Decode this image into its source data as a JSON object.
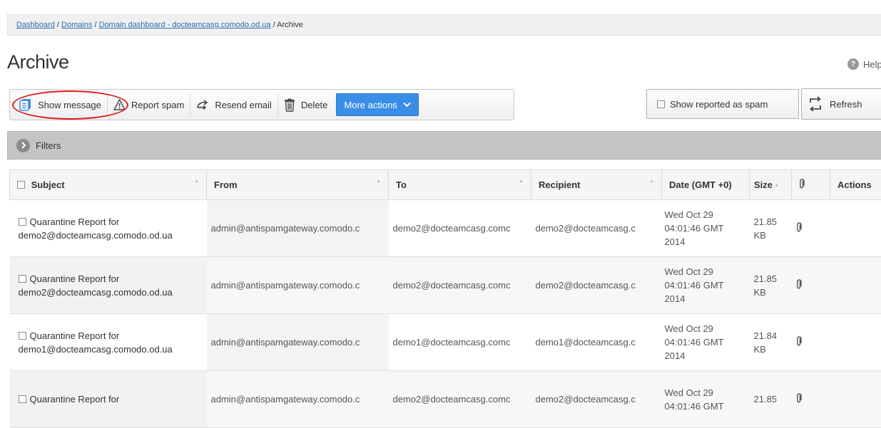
{
  "breadcrumb": {
    "links": [
      "Dashboard",
      "Domains",
      "Domain dashboard - docteamcasg.comodo.od.ua"
    ],
    "separator": "/",
    "current": "Archive"
  },
  "page": {
    "title": "Archive",
    "help_label": "Help"
  },
  "toolbar": {
    "show_message": "Show message",
    "report_spam": "Report spam",
    "resend_email": "Resend email",
    "delete": "Delete",
    "more_actions": "More actions"
  },
  "right_controls": {
    "show_reported_spam": "Show reported as spam",
    "refresh": "Refresh"
  },
  "filters": {
    "label": "Filters"
  },
  "table": {
    "columns": {
      "subject": "Subject",
      "from": "From",
      "to": "To",
      "recipient": "Recipient",
      "date": "Date (GMT +0)",
      "size": "Size",
      "actions": "Actions"
    },
    "rows": [
      {
        "subject_line1": "Quarantine Report for",
        "subject_line2": "demo2@docteamcasg.comodo.od.ua",
        "from": "admin@antispamgateway.comodo.c",
        "to": "demo2@docteamcasg.comc",
        "recipient": "demo2@docteamcasg.c",
        "date_line1": "Wed Oct 29",
        "date_line2": "04:01:46 GMT",
        "date_line3": "2014",
        "size_line1": "21.85",
        "size_line2": "KB"
      },
      {
        "subject_line1": "Quarantine Report for",
        "subject_line2": "demo2@docteamcasg.comodo.od.ua",
        "from": "admin@antispamgateway.comodo.c",
        "to": "demo2@docteamcasg.comc",
        "recipient": "demo2@docteamcasg.c",
        "date_line1": "Wed Oct 29",
        "date_line2": "04:01:46 GMT",
        "date_line3": "2014",
        "size_line1": "21.85",
        "size_line2": "KB"
      },
      {
        "subject_line1": "Quarantine Report for",
        "subject_line2": "demo1@docteamcasg.comodo.od.ua",
        "from": "admin@antispamgateway.comodo.c",
        "to": "demo1@docteamcasg.comc",
        "recipient": "demo1@docteamcasg.c",
        "date_line1": "Wed Oct 29",
        "date_line2": "04:01:46 GMT",
        "date_line3": "2014",
        "size_line1": "21.84",
        "size_line2": "KB"
      },
      {
        "subject_line1": "Quarantine Report for",
        "subject_line2": "",
        "from": "admin@antispamgateway.comodo.c",
        "to": "demo2@docteamcasg.comc",
        "recipient": "demo2@docteamcasg.c",
        "date_line1": "Wed Oct 29",
        "date_line2": "04:01:46 GMT",
        "date_line3": "",
        "size_line1": "21.85",
        "size_line2": ""
      }
    ]
  },
  "colors": {
    "link": "#2b6cb0",
    "primary_button": "#3a8ee8",
    "highlight": "#e01b1b",
    "filters_bar": "#c4c4c4"
  },
  "icons": {
    "show_message": "message-icon",
    "report_spam": "warning-icon",
    "resend_email": "resend-icon",
    "delete": "trash-icon",
    "more_actions": "chevron-down-icon",
    "refresh": "refresh-icon",
    "filters": "chevron-right-icon",
    "help": "help-icon",
    "attachment": "paperclip-icon"
  }
}
